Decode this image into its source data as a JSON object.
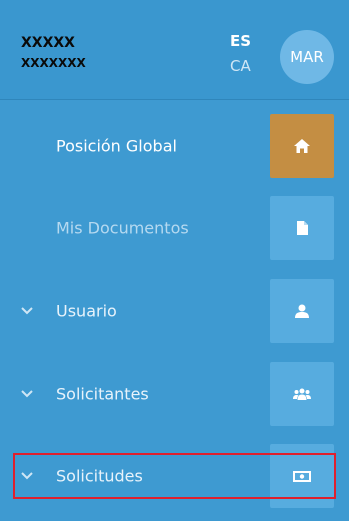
{
  "user": {
    "name_line1": "XXXXX",
    "name_line2": "XXXXXXX",
    "avatar_initials": "MAR"
  },
  "language": {
    "active": "ES",
    "other": "CA"
  },
  "menu": [
    {
      "label": "Posición Global",
      "icon": "home-icon",
      "active": true,
      "expandable": false
    },
    {
      "label": "Mis Documentos",
      "icon": "document-icon",
      "active": false,
      "expandable": false
    },
    {
      "label": "Usuario",
      "icon": "user-icon",
      "active": false,
      "expandable": true
    },
    {
      "label": "Solicitantes",
      "icon": "users-icon",
      "active": false,
      "expandable": true
    },
    {
      "label": "Solicitudes",
      "icon": "money-icon",
      "active": false,
      "expandable": true
    }
  ],
  "colors": {
    "background": "#3e9ad1",
    "tile": "#57acdf",
    "active_tile": "#c48e43",
    "highlight": "#e0202d"
  }
}
